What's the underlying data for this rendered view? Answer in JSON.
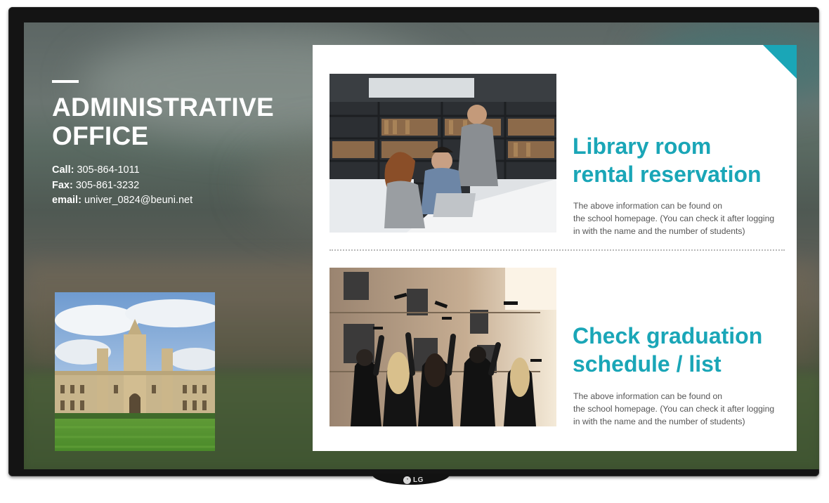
{
  "office": {
    "title_line1": "ADMINISTRATIVE",
    "title_line2": "OFFICE",
    "call_label": "Call:",
    "call_value": "305-864-1011",
    "fax_label": "Fax:",
    "fax_value": "305-861-3232",
    "email_label": "email:",
    "email_value": "univer_0824@beuni.net"
  },
  "features": [
    {
      "title_line1": "Library room",
      "title_line2": "rental reservation",
      "desc_line1": "The above information can be found on",
      "desc_line2": "the school homepage. (You can check it after logging",
      "desc_line3": "in with the name and the number of students)"
    },
    {
      "title_line1": "Check graduation",
      "title_line2": "schedule / list",
      "desc_line1": "The above information can be found on",
      "desc_line2": "the school homepage. (You can check it after logging",
      "desc_line3": "in with the name and the number of students)"
    }
  ],
  "device": {
    "brand": "LG"
  },
  "colors": {
    "accent": "#1aa6b7",
    "bezel": "#141414",
    "card": "#ffffff"
  },
  "images": [
    "campus-building-photo",
    "library-students-photo",
    "graduates-caps-photo"
  ]
}
